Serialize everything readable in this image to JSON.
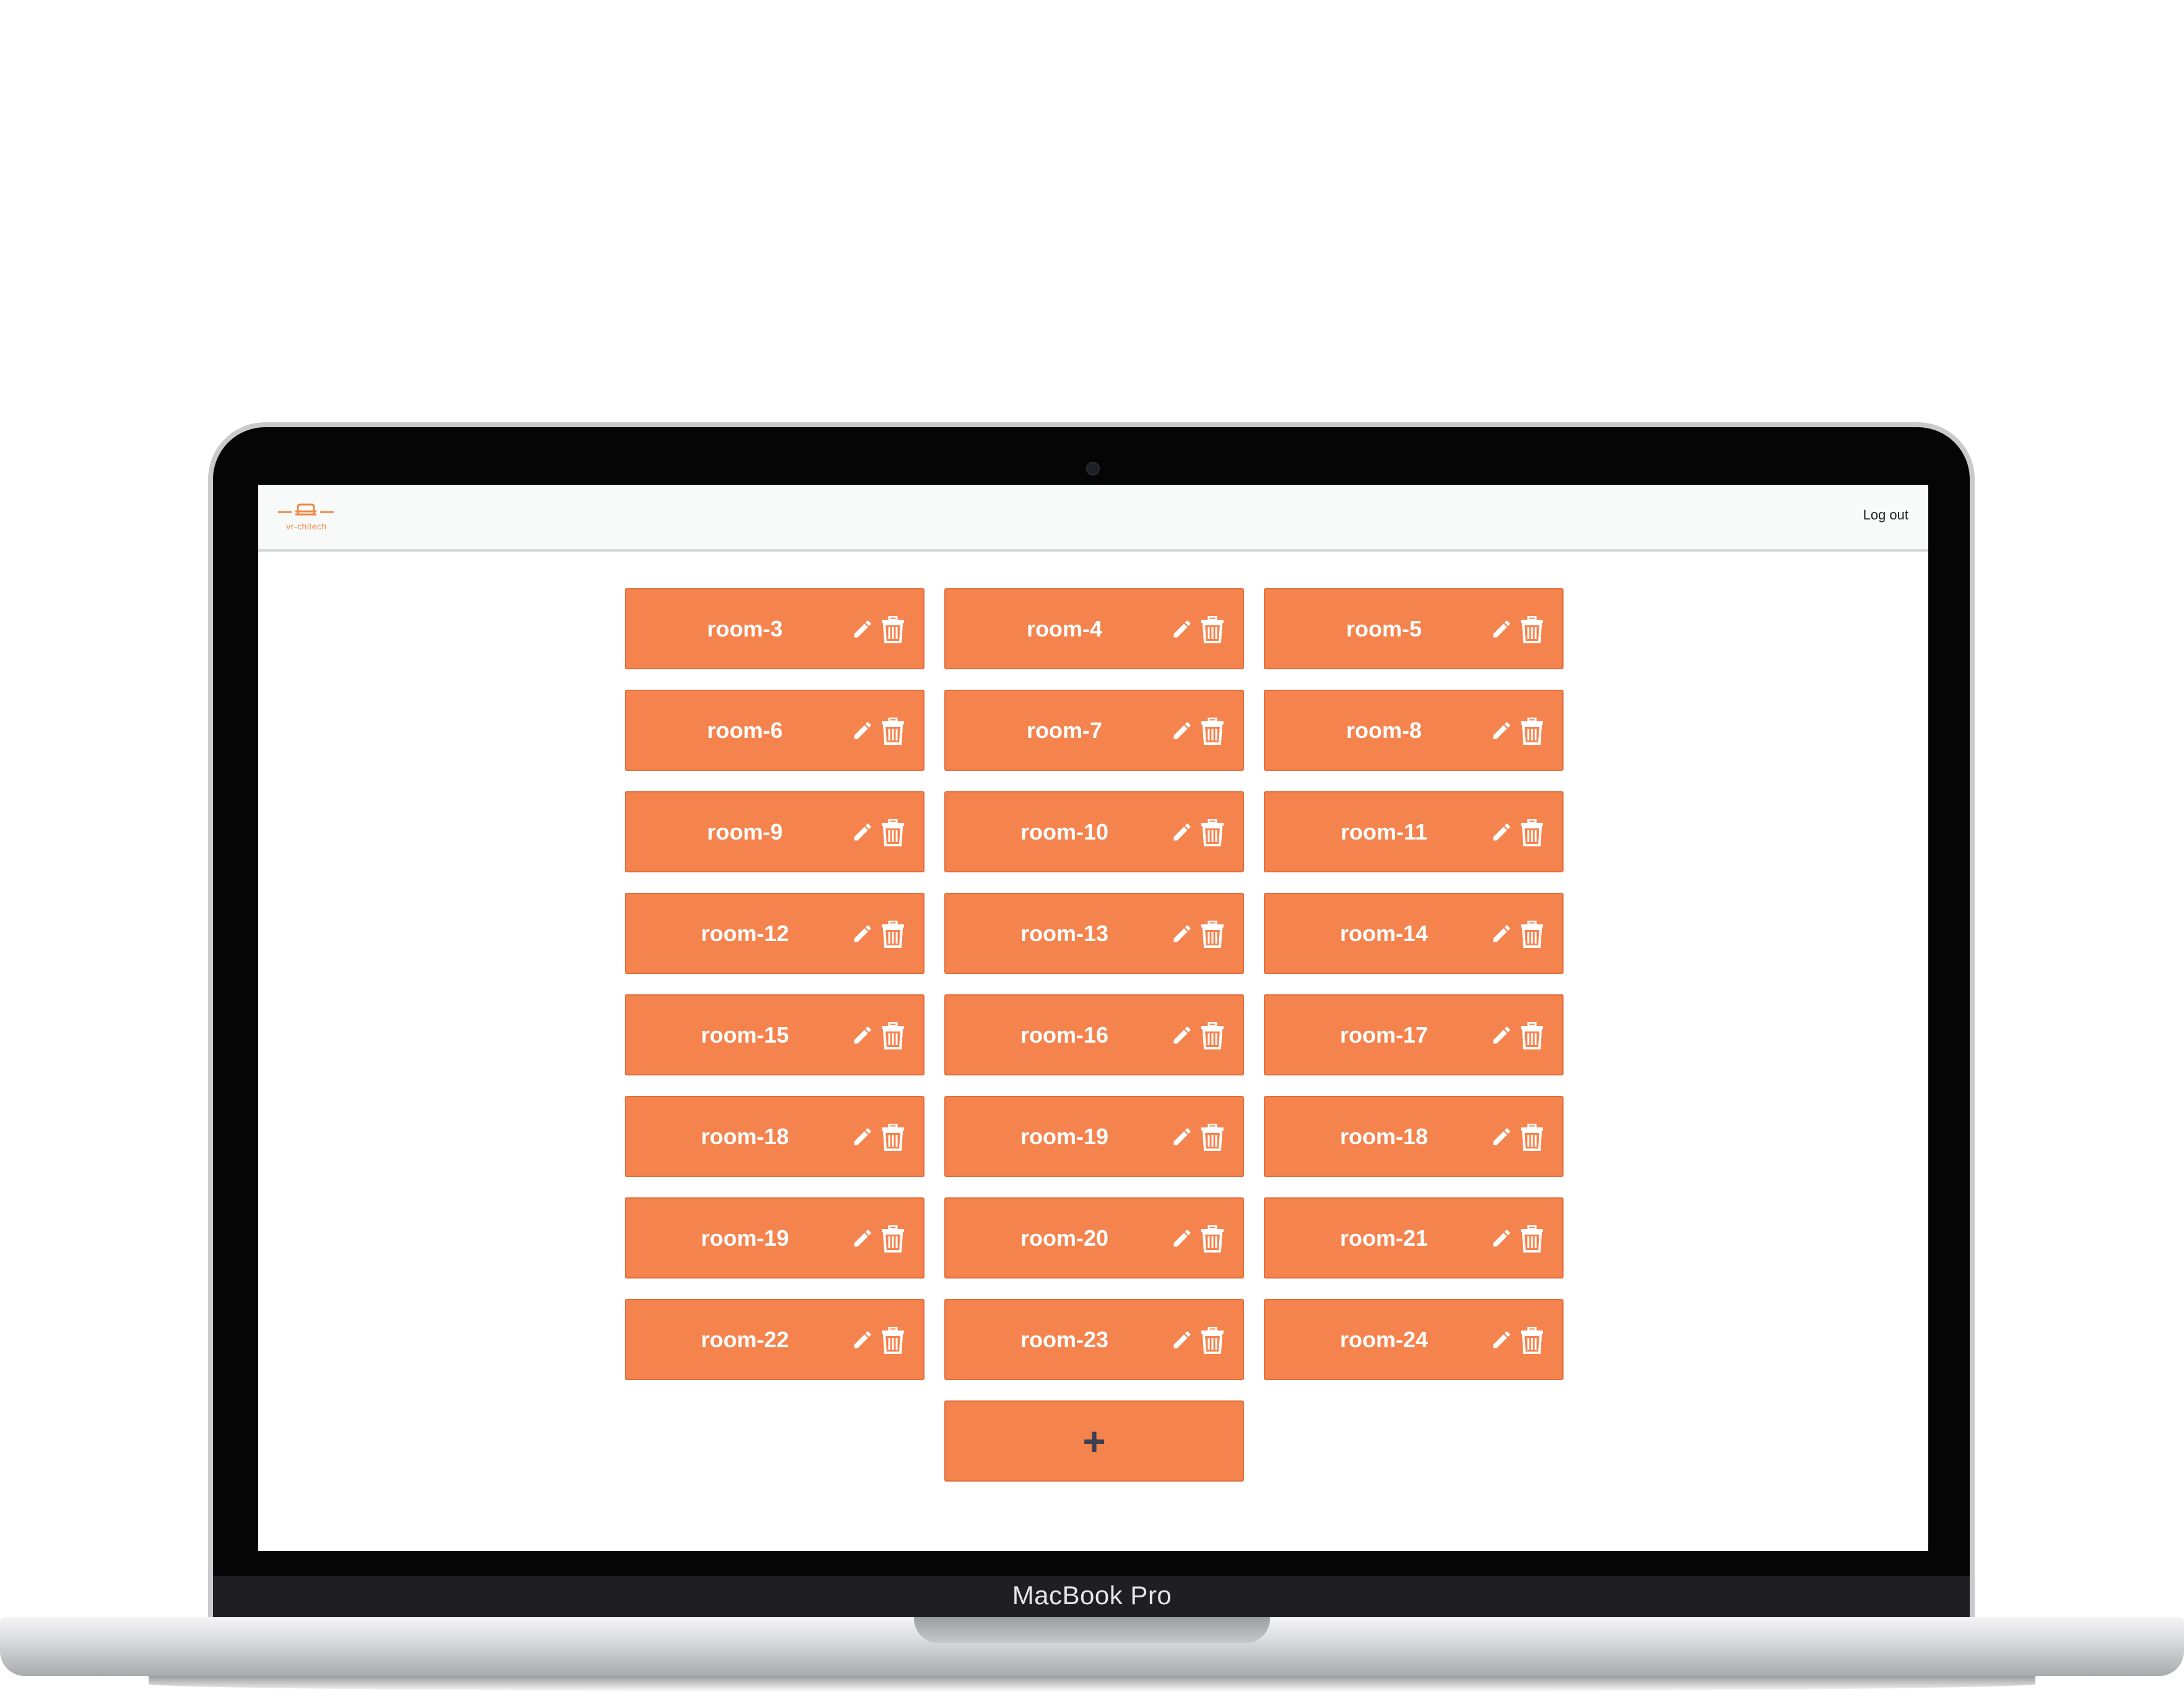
{
  "app": {
    "brand": "vr-chitech",
    "logout_label": "Log out",
    "accent_color": "#f5834e"
  },
  "device": {
    "label": "MacBook Pro"
  },
  "rooms": [
    {
      "name": "room-3"
    },
    {
      "name": "room-4"
    },
    {
      "name": "room-5"
    },
    {
      "name": "room-6"
    },
    {
      "name": "room-7"
    },
    {
      "name": "room-8"
    },
    {
      "name": "room-9"
    },
    {
      "name": "room-10"
    },
    {
      "name": "room-11"
    },
    {
      "name": "room-12"
    },
    {
      "name": "room-13"
    },
    {
      "name": "room-14"
    },
    {
      "name": "room-15"
    },
    {
      "name": "room-16"
    },
    {
      "name": "room-17"
    },
    {
      "name": "room-18"
    },
    {
      "name": "room-19"
    },
    {
      "name": "room-18"
    },
    {
      "name": "room-19"
    },
    {
      "name": "room-20"
    },
    {
      "name": "room-21"
    },
    {
      "name": "room-22"
    },
    {
      "name": "room-23"
    },
    {
      "name": "room-24"
    }
  ],
  "room_actions": {
    "edit_icon": "pencil-icon",
    "delete_icon": "trash-icon"
  },
  "add_button": {
    "label": "+"
  }
}
